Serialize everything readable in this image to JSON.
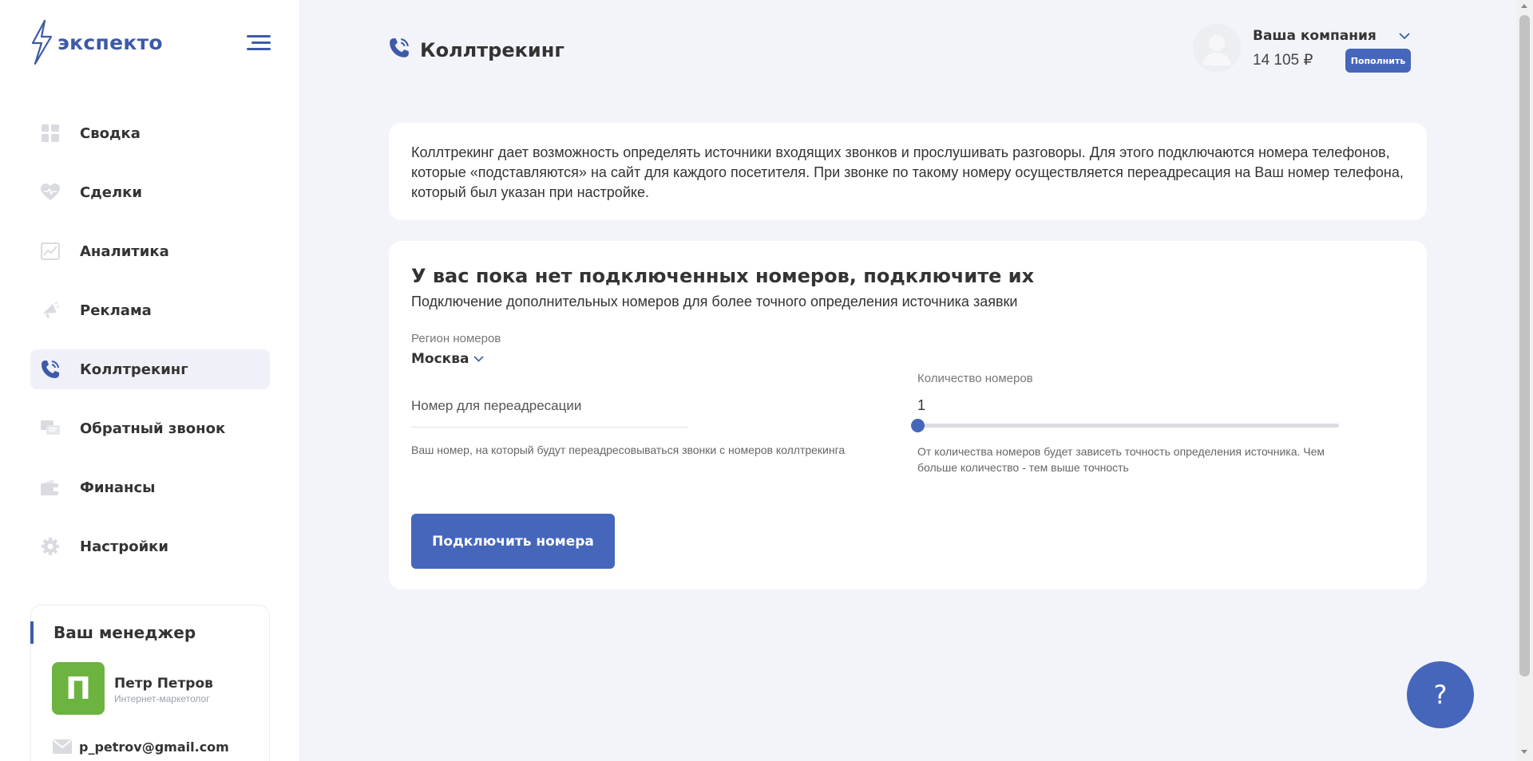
{
  "brand": {
    "name": "экспекто",
    "color": "#3d5aa8"
  },
  "sidebar": {
    "items": [
      {
        "label": "Сводка",
        "icon": "dashboard-icon",
        "active": false
      },
      {
        "label": "Сделки",
        "icon": "heart-handshake-icon",
        "active": false
      },
      {
        "label": "Аналитика",
        "icon": "analytics-chart-icon",
        "active": false
      },
      {
        "label": "Реклама",
        "icon": "megaphone-icon",
        "active": false
      },
      {
        "label": "Коллтрекинг",
        "icon": "phone-icon",
        "active": true
      },
      {
        "label": "Обратный звонок",
        "icon": "chat-bubbles-icon",
        "active": false
      },
      {
        "label": "Финансы",
        "icon": "wallet-icon",
        "active": false
      },
      {
        "label": "Настройки",
        "icon": "gear-icon",
        "active": false
      }
    ]
  },
  "manager": {
    "title": "Ваш менеджер",
    "initial": "П",
    "name": "Петр Петров",
    "role": "Интернет-маркетолог",
    "email": "p_petrov@gmail.com"
  },
  "header": {
    "title": "Коллтрекинг",
    "company": "Ваша компания",
    "balance": "14 105 ₽",
    "topup_label": "Пополнить"
  },
  "info": {
    "text": "Коллтрекинг дает возможность определять источники входящих звонков и прослушивать разговоры. Для этого подключаются номера телефонов, которые «подставляются» на сайт для каждого посетителя. При звонке по такому номеру осуществляется переадресация на Ваш номер телефона, который был указан при настройке."
  },
  "connect": {
    "title": "У вас пока нет подключенных номеров, подключите их",
    "subtitle": "Подключение дополнительных номеров для более точного определения источника заявки",
    "region_label": "Регион номеров",
    "region_value": "Москва",
    "redirect_placeholder": "Номер для переадресации",
    "redirect_hint": "Ваш номер, на который будут переадресовываться звонки с номеров коллтрекинга",
    "quantity_label": "Количество номеров",
    "quantity_value": "1",
    "quantity_hint": "От количества номеров будет зависеть точность определения источника. Чем больше количество - тем выше точность",
    "button_label": "Подключить номера"
  },
  "help": {
    "label": "?"
  },
  "colors": {
    "accent": "#4566bb",
    "manager_avatar": "#6db33f",
    "background": "#f3f4fa"
  }
}
